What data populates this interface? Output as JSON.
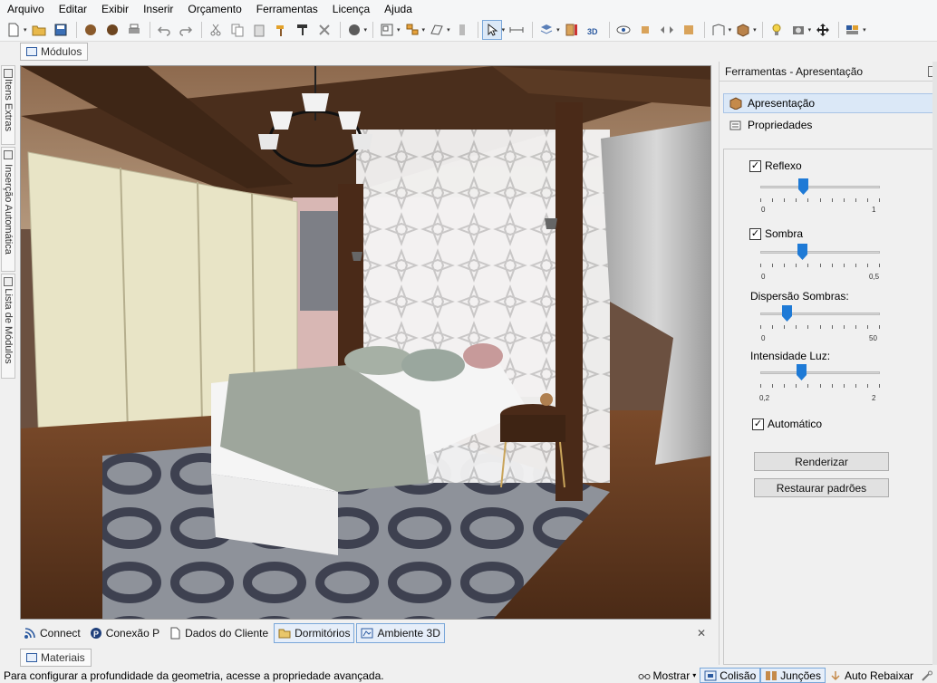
{
  "menu": [
    "Arquivo",
    "Editar",
    "Exibir",
    "Inserir",
    "Orçamento",
    "Ferramentas",
    "Licença",
    "Ajuda"
  ],
  "top_tab": {
    "label": "Módulos"
  },
  "left_tabs": [
    "Itens Extras",
    "Inserção Automática",
    "Lista de Módulos"
  ],
  "panel": {
    "title": "Ferramentas - Apresentação",
    "tabs": [
      "Apresentação",
      "Propriedades"
    ],
    "reflexo": {
      "label": "Reflexo",
      "checked": true,
      "min": "0",
      "max": "1",
      "value": 0.35
    },
    "sombra": {
      "label": "Sombra",
      "checked": true,
      "min": "0",
      "max": "0,5",
      "value": 0.17
    },
    "dispersao": {
      "label": "Dispersão Sombras:",
      "min": "0",
      "max": "50",
      "value": 10
    },
    "intensidade": {
      "label": "Intensidade Luz:",
      "min": "0,2",
      "max": "2",
      "value": 0.8
    },
    "automatico": {
      "label": "Automático",
      "checked": true
    },
    "render_button": "Renderizar",
    "reset_button": "Restaurar padrões"
  },
  "bottom_tabs": [
    "Connect",
    "Conexão P",
    "Dados do Cliente",
    "Dormitórios",
    "Ambiente 3D"
  ],
  "materials_tab": "Materiais",
  "status": {
    "message": "Para configurar a profundidade da geometria, acesse a propriedade avançada.",
    "mostrar": "Mostrar",
    "colisao": "Colisão",
    "juncoes": "Junções",
    "auto_rebaixar": "Auto Rebaixar"
  },
  "checkmark": "✓",
  "close_glyph": "✕",
  "dropdown_glyph": "▾"
}
